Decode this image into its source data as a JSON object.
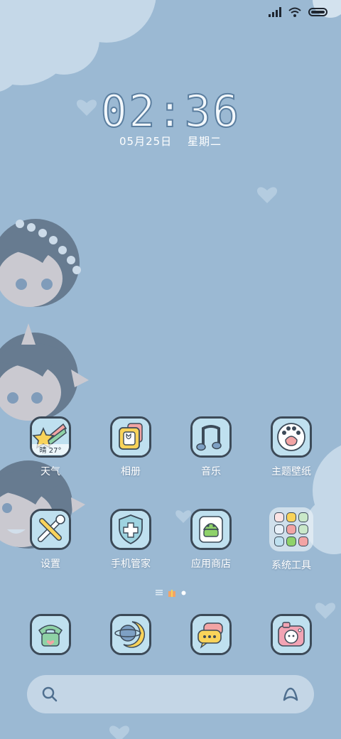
{
  "lockscreen": {
    "time": "02:36",
    "date": "05月25日",
    "weekday": "星期二"
  },
  "status_bar": {
    "icons": [
      "signal-icon",
      "wifi-icon",
      "battery-icon"
    ]
  },
  "apps": [
    {
      "id": "weather",
      "label": "天气",
      "sub": "晴 27°",
      "icon": "shooting-star-icon"
    },
    {
      "id": "gallery",
      "label": "相册",
      "icon": "photo-frame-icon"
    },
    {
      "id": "music",
      "label": "音乐",
      "icon": "music-note-icon"
    },
    {
      "id": "themes",
      "label": "主题壁纸",
      "icon": "paw-icon"
    },
    {
      "id": "settings",
      "label": "设置",
      "icon": "wrench-screwdriver-icon"
    },
    {
      "id": "security",
      "label": "手机管家",
      "icon": "shield-icon"
    },
    {
      "id": "appstore",
      "label": "应用商店",
      "icon": "android-icon"
    },
    {
      "id": "tools",
      "label": "系统工具",
      "icon": "folder-icon"
    }
  ],
  "dock": [
    {
      "id": "phone",
      "icon": "telephone-icon"
    },
    {
      "id": "browser",
      "icon": "planet-icon"
    },
    {
      "id": "messages",
      "icon": "chat-bubble-icon"
    },
    {
      "id": "camera",
      "icon": "camera-icon"
    }
  ],
  "pager": {
    "pages": 2,
    "current": 2
  },
  "search_bar": {
    "left_icon": "search-icon",
    "right_icon": "assistant-icon"
  },
  "colors": {
    "background": "#9bb9d3",
    "tile_bg": "#ffffff",
    "tile_border": "#3c4a58",
    "clock_outline": "#5c7fa0",
    "search_bar": "#c4d6e6"
  }
}
